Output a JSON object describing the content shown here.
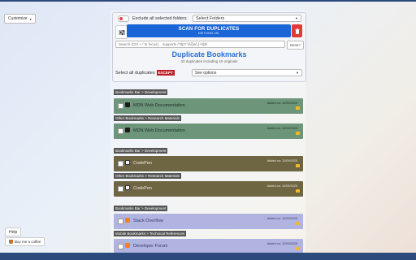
{
  "customize": {
    "label": "Customize",
    "caret": "▾"
  },
  "help": {
    "label": "Help"
  },
  "coffee": {
    "label": "Buy me a coffee"
  },
  "controls": {
    "exclude_label": "Exclude all selected folders",
    "folder_select": "Select Folders",
    "scan_title": "SCAN FOR DUPLICATES",
    "scan_sub": "MATCHING URL",
    "search_placeholder": "Search (Ctrl + / to focus)... supports /^ttp?:\\/\\/[\\w\\.]+\\/|$/",
    "reset_label": "RESET",
    "title": "Duplicate Bookmarks",
    "subtitle": "32 duplicates including 15 originals",
    "select_all": "Select all duplicates",
    "except": "EXCEPT",
    "options": "See options"
  },
  "groups": [
    {
      "theme": "g-green",
      "entries": [
        {
          "path": "Bookmarks Bar > Development",
          "name": "MDN Web Documentation",
          "added": "Added on: 12/09/2025",
          "favicon": "mdn-icon",
          "favcolor": "#1b1b1b"
        },
        {
          "path": "Other Bookmarks > Research Materials",
          "name": "MDN Web Documentation",
          "added": "Added on: 12/09/2025",
          "favicon": "mdn-icon",
          "favcolor": "#1b1b1b"
        }
      ]
    },
    {
      "theme": "g-olive",
      "entries": [
        {
          "path": "Bookmarks Bar > Development",
          "name": "CodePen",
          "added": "Added on: 12/09/2025",
          "favicon": "codepen-icon",
          "favcolor": "#f1f1f1"
        },
        {
          "path": "Other Bookmarks > Research Materials",
          "name": "CodePen",
          "added": "Added on: 12/09/2025",
          "favicon": "codepen-icon",
          "favcolor": "#f1f1f1"
        }
      ]
    },
    {
      "theme": "g-lav",
      "entries": [
        {
          "path": "Bookmarks Bar > Development",
          "name": "Stack Overflow",
          "added": "Added on: 12/09/2025",
          "favicon": "stackoverflow-icon",
          "favcolor": "#f48024"
        },
        {
          "path": "Mobile Bookmarks > Technical References",
          "name": "Developer Forum",
          "added": "Added on: 12/09/2025",
          "favicon": "forum-icon",
          "favcolor": "#f48024"
        }
      ]
    }
  ]
}
